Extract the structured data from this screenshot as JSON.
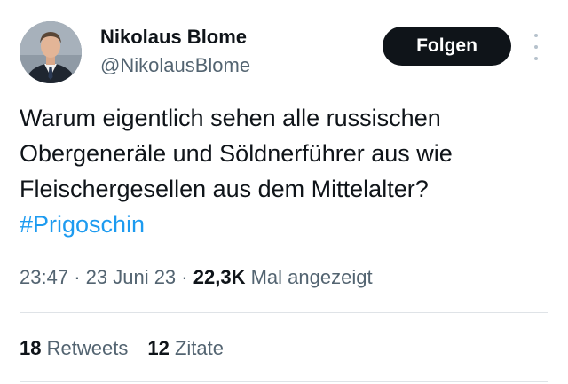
{
  "author": {
    "name": "Nikolaus Blome",
    "handle": "@NikolausBlome",
    "follow_label": "Folgen"
  },
  "icons": {
    "more": "more-vertical-icon",
    "avatar": "profile-avatar"
  },
  "tweet": {
    "lines": [
      "Warum eigentlich sehen alle russischen",
      "Obergeneräle und Söldnerführer aus wie",
      "Fleischergesellen aus dem Mittelalter?"
    ],
    "hashtag": "#Prigoschin"
  },
  "meta": {
    "time": "23:47",
    "separator": "·",
    "date": "23 Juni 23",
    "views_count": "22,3K",
    "views_label": "Mal angezeigt"
  },
  "stats": {
    "retweets_count": "18",
    "retweets_label": "Retweets",
    "quotes_count": "12",
    "quotes_label": "Zitate"
  },
  "colors": {
    "text": "#0f1419",
    "secondary": "#536471",
    "link": "#1d9bf0",
    "button_bg": "#0f1419",
    "button_text": "#ffffff",
    "divider": "#dfe3e7"
  }
}
